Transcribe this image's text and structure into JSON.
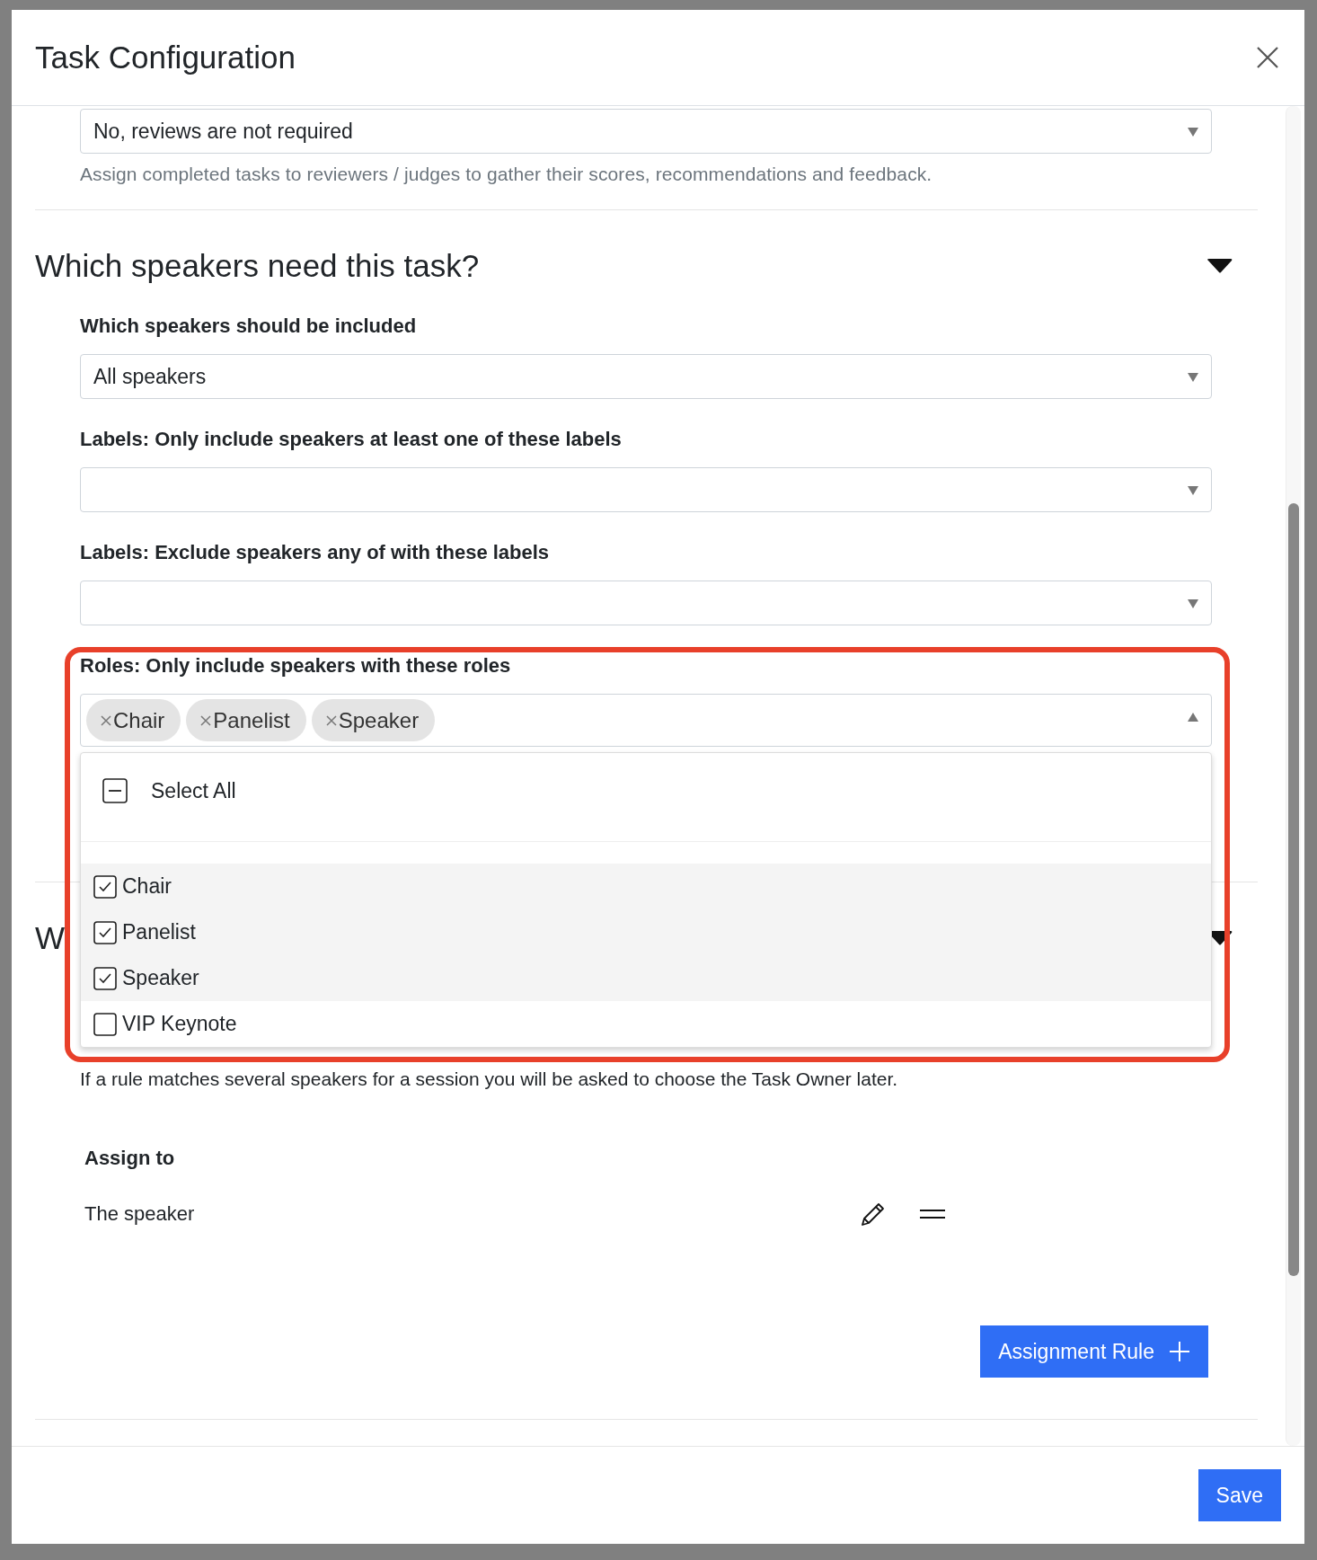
{
  "dialog": {
    "title": "Task Configuration"
  },
  "review": {
    "value": "No, reviews are not required",
    "help": "Assign completed tasks to reviewers / judges to gather their scores, recommendations and feedback."
  },
  "speakers_section": {
    "title": "Which speakers need this task?",
    "expanded": true,
    "fields": [
      {
        "label": "Which speakers should be included",
        "value": "All speakers"
      },
      {
        "label": "Labels: Only include speakers at least one of these labels"
      },
      {
        "label": "Labels: Exclude speakers any of with these labels"
      }
    ],
    "roles": {
      "label": "Roles: Only include speakers with these roles",
      "open": true,
      "highlighted": true,
      "tags": [
        "Chair",
        "Panelist",
        "Speaker"
      ],
      "select_all": {
        "label": "Select All",
        "indeterminate": true
      },
      "options": [
        {
          "label": "Chair",
          "checked": true
        },
        {
          "label": "Panelist",
          "checked": true
        },
        {
          "label": "Speaker",
          "checked": true
        },
        {
          "label": "VIP Keynote",
          "checked": false
        }
      ]
    }
  },
  "next_section": {
    "title": "W",
    "expanded": true,
    "note": "If a rule matches several speakers for a session you will be asked to choose the Task Owner later."
  },
  "assignment": {
    "label": "Assign to",
    "rules": [
      {
        "text": "The speaker"
      }
    ],
    "add_button": "Assignment Rule"
  },
  "footer": {
    "save": "Save"
  }
}
